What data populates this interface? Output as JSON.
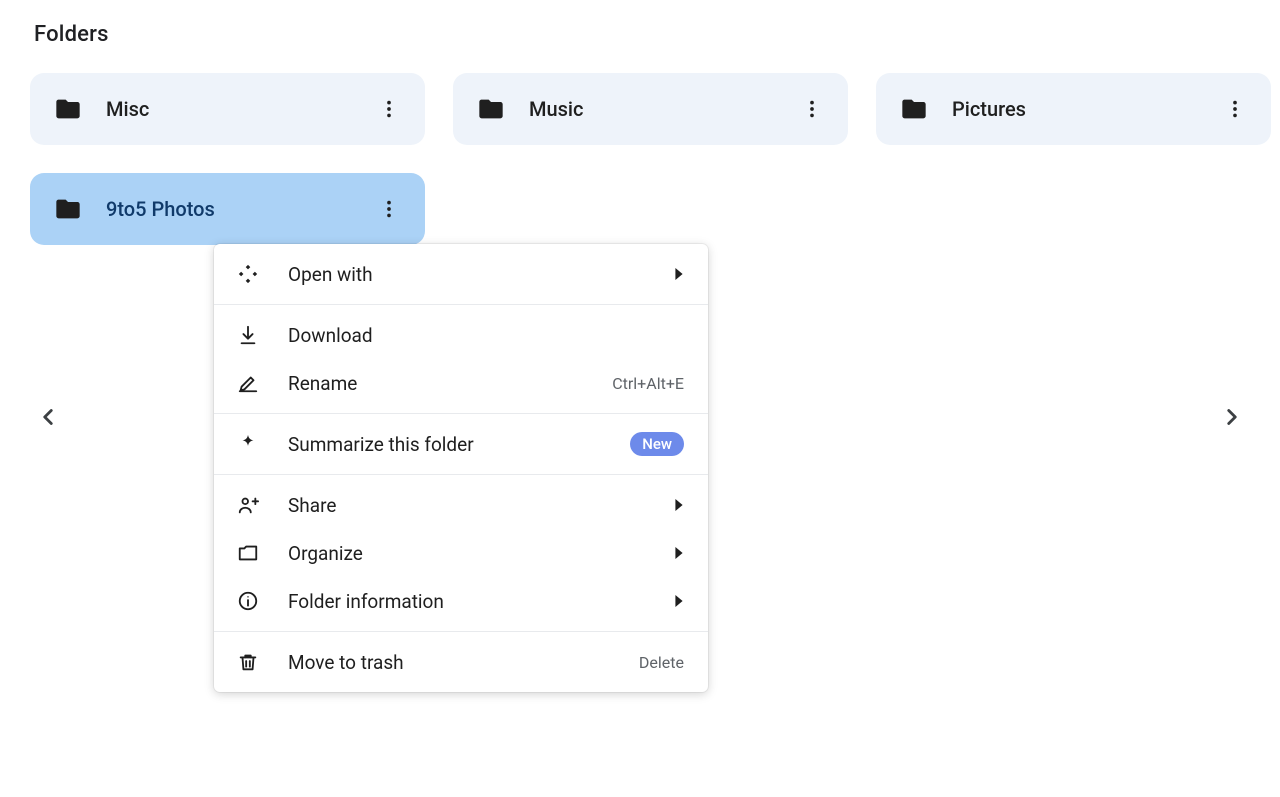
{
  "heading": "Folders",
  "folders": [
    {
      "name": "Misc",
      "selected": false
    },
    {
      "name": "Music",
      "selected": false
    },
    {
      "name": "Pictures",
      "selected": false
    },
    {
      "name": "9to5 Photos",
      "selected": true
    }
  ],
  "menu": {
    "open_with": "Open with",
    "download": "Download",
    "rename": "Rename",
    "rename_shortcut": "Ctrl+Alt+E",
    "summarize": "Summarize this folder",
    "summarize_badge": "New",
    "share": "Share",
    "organize": "Organize",
    "folder_info": "Folder information",
    "move_to_trash": "Move to trash",
    "trash_shortcut": "Delete"
  }
}
